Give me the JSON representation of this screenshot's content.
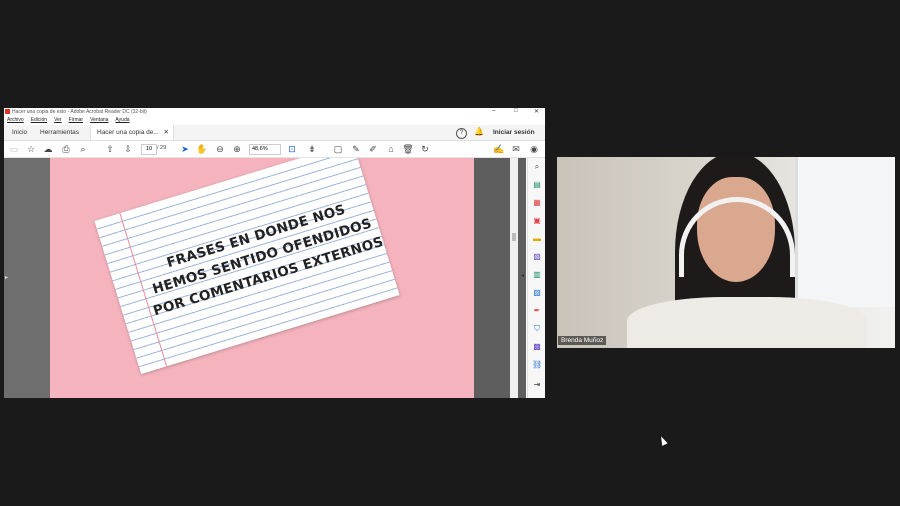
{
  "window": {
    "title": "Hacer una copia de esto - Adobe Acrobat Reader DC (32-bit)",
    "controls": [
      "–",
      "□",
      "✕"
    ]
  },
  "menu": [
    "Archivo",
    "Edición",
    "Ver",
    "Firmar",
    "Ventana",
    "Ayuda"
  ],
  "tabs": {
    "home": "Inicio",
    "tools": "Herramientas",
    "document": "Hacer una copia de...",
    "close": "✕",
    "signin": "Iniciar sesión"
  },
  "toolbar": {
    "page_current": "10",
    "page_total": "/ 29",
    "zoom": "48,6%"
  },
  "document": {
    "note_text": "FRASES EN DONDE NOS HEMOS SENTIDO OFENDIDOS POR COMENTARIOS EXTERNOS"
  },
  "webcam": {
    "participant_name": "Brenda Muñoz"
  },
  "colors": {
    "page_background": "#f4b3bd",
    "desktop_background": "#1a1a1a"
  }
}
